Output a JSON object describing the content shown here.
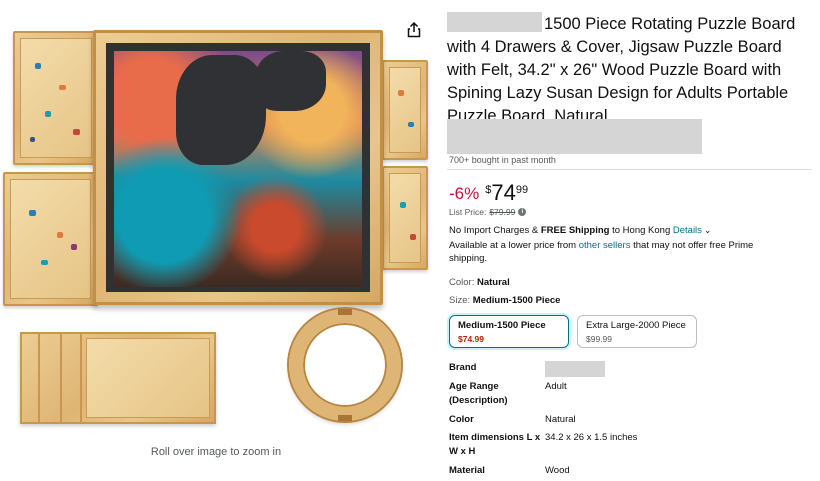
{
  "gallery": {
    "zoom_hint": "Roll over image to zoom in",
    "share_icon": "share-icon",
    "image_subject": "rotating-puzzle-board-with-drawers"
  },
  "product": {
    "title": "1500 Piece Rotating Puzzle Board with 4 Drawers & Cover, Jigsaw Puzzle Board with Felt, 34.2\" x 26\" Wood Puzzle Board with Spining Lazy Susan Design for Adults Portable Puzzle Board, Natural",
    "bought_past_month": "700+ bought in past month",
    "price": {
      "discount": "-6%",
      "currency_symbol": "$",
      "whole": "74",
      "fraction": "99",
      "list_price_label": "List Price:",
      "list_price_value": "$79.99"
    },
    "shipping": {
      "prefix": "No Import Charges & ",
      "free_shipping": "FREE Shipping",
      "middle": " to Hong Kong ",
      "details_link": "Details"
    },
    "lower_price": {
      "prefix": "Available at a lower price from ",
      "link": "other sellers",
      "suffix": " that may not offer free Prime shipping."
    },
    "color": {
      "label": "Color:",
      "value": "Natural"
    },
    "size": {
      "label": "Size:",
      "value": "Medium-1500 Piece",
      "options": [
        {
          "name": "Medium-1500 Piece",
          "price": "$74.99",
          "selected": true
        },
        {
          "name": "Extra Large-2000 Piece",
          "price": "$99.99",
          "selected": false
        }
      ]
    },
    "specs": [
      {
        "key": "Brand",
        "value": ""
      },
      {
        "key": "Age Range (Description)",
        "value": "Adult"
      },
      {
        "key": "Color",
        "value": "Natural"
      },
      {
        "key": "Item dimensions L x W x H",
        "value": "34.2 x 26 x 1.5 inches"
      },
      {
        "key": "Material",
        "value": "Wood"
      }
    ]
  },
  "colors": {
    "discount": "#cc0c39",
    "link": "#007185",
    "selected_price": "#b12704",
    "wood": "#deb575"
  }
}
